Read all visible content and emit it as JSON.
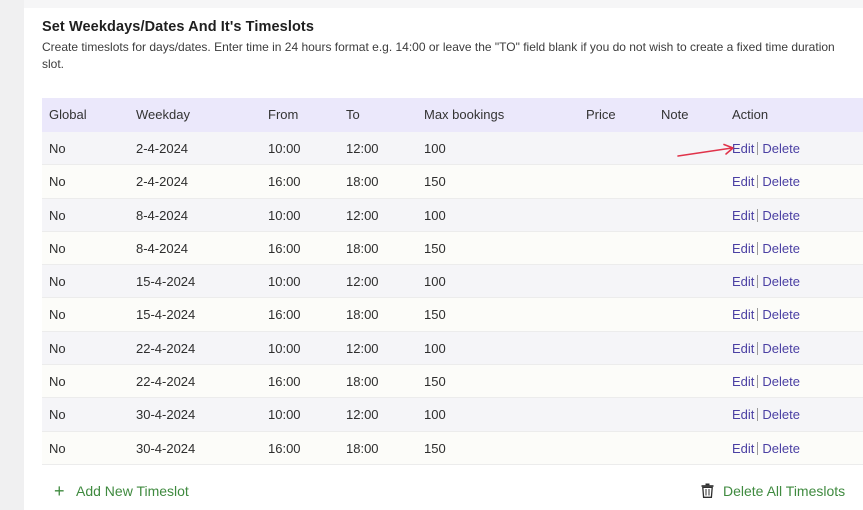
{
  "section": {
    "title": "Set Weekdays/Dates And It's Timeslots",
    "description": "Create timeslots for days/dates. Enter time in 24 hours format e.g. 14:00 or leave the \"TO\" field blank if you do not wish to create a fixed time duration slot."
  },
  "table": {
    "headers": {
      "global": "Global",
      "weekday": "Weekday",
      "from": "From",
      "to": "To",
      "max_bookings": "Max bookings",
      "price": "Price",
      "note": "Note",
      "action": "Action"
    },
    "edit_label": "Edit",
    "delete_label": "Delete",
    "rows": [
      {
        "global": "No",
        "weekday": "2-4-2024",
        "from": "10:00",
        "to": "12:00",
        "max": "100",
        "price": "",
        "note": ""
      },
      {
        "global": "No",
        "weekday": "2-4-2024",
        "from": "16:00",
        "to": "18:00",
        "max": "150",
        "price": "",
        "note": ""
      },
      {
        "global": "No",
        "weekday": "8-4-2024",
        "from": "10:00",
        "to": "12:00",
        "max": "100",
        "price": "",
        "note": ""
      },
      {
        "global": "No",
        "weekday": "8-4-2024",
        "from": "16:00",
        "to": "18:00",
        "max": "150",
        "price": "",
        "note": ""
      },
      {
        "global": "No",
        "weekday": "15-4-2024",
        "from": "10:00",
        "to": "12:00",
        "max": "100",
        "price": "",
        "note": ""
      },
      {
        "global": "No",
        "weekday": "15-4-2024",
        "from": "16:00",
        "to": "18:00",
        "max": "150",
        "price": "",
        "note": ""
      },
      {
        "global": "No",
        "weekday": "22-4-2024",
        "from": "10:00",
        "to": "12:00",
        "max": "100",
        "price": "",
        "note": ""
      },
      {
        "global": "No",
        "weekday": "22-4-2024",
        "from": "16:00",
        "to": "18:00",
        "max": "150",
        "price": "",
        "note": ""
      },
      {
        "global": "No",
        "weekday": "30-4-2024",
        "from": "10:00",
        "to": "12:00",
        "max": "100",
        "price": "",
        "note": ""
      },
      {
        "global": "No",
        "weekday": "30-4-2024",
        "from": "16:00",
        "to": "18:00",
        "max": "150",
        "price": "",
        "note": ""
      }
    ]
  },
  "footer": {
    "add_label": "Add New Timeslot",
    "delete_all_label": "Delete All Timeslots",
    "add_icon": "plus-icon",
    "delete_icon": "trash-icon"
  },
  "colors": {
    "header_bg": "#ebe8fb",
    "link": "#4a3fa3",
    "footer_green": "#3f8a3f",
    "annotation_arrow": "#e0334a"
  }
}
